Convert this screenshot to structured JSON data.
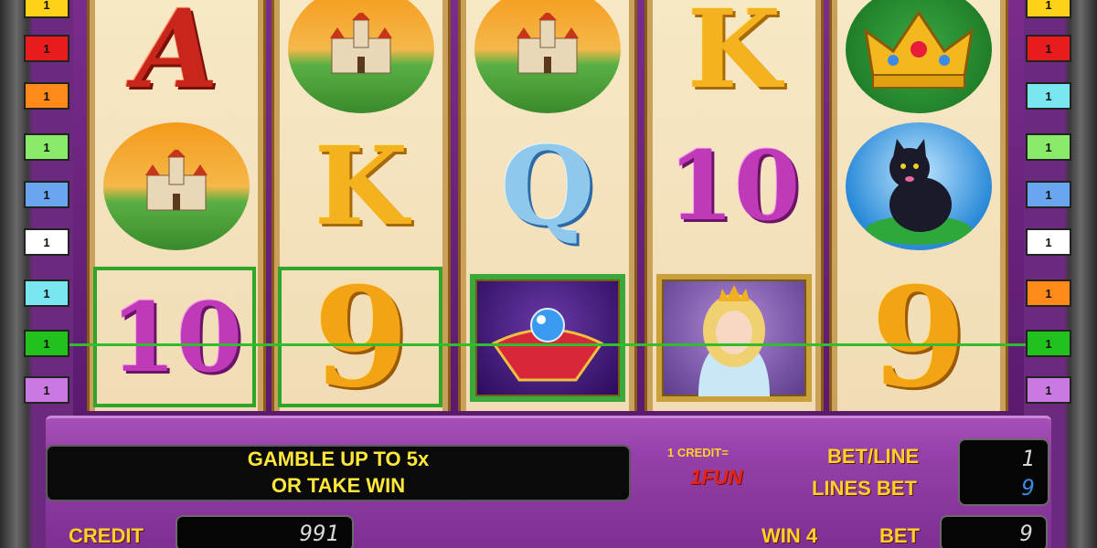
{
  "reels": [
    [
      "A",
      "castle",
      "10"
    ],
    [
      "castle",
      "K",
      "9"
    ],
    [
      "castle",
      "Q",
      "gem"
    ],
    [
      "K",
      "10",
      "princess"
    ],
    [
      "crown",
      "cat",
      "9"
    ]
  ],
  "markers": {
    "left": [
      {
        "label": "1",
        "color": "#ffd21a"
      },
      {
        "label": "1",
        "color": "#e81c1c"
      },
      {
        "label": "1",
        "color": "#ff8a1a"
      },
      {
        "label": "1",
        "color": "#8aea6a"
      },
      {
        "label": "1",
        "color": "#6aa6f0"
      },
      {
        "label": "1",
        "color": "#ffffff"
      },
      {
        "label": "1",
        "color": "#7ae6f0"
      },
      {
        "label": "1",
        "color": "#22c21e"
      },
      {
        "label": "1",
        "color": "#c87ae0"
      }
    ],
    "right": [
      {
        "label": "1",
        "color": "#ffd21a"
      },
      {
        "label": "1",
        "color": "#e81c1c"
      },
      {
        "label": "1",
        "color": "#7ae6f0"
      },
      {
        "label": "1",
        "color": "#8aea6a"
      },
      {
        "label": "1",
        "color": "#6aa6f0"
      },
      {
        "label": "1",
        "color": "#ffffff"
      },
      {
        "label": "1",
        "color": "#ff8a1a"
      },
      {
        "label": "1",
        "color": "#22c21e"
      },
      {
        "label": "1",
        "color": "#c87ae0"
      }
    ]
  },
  "message": {
    "line1": "GAMBLE UP TO 5x",
    "line2": "OR TAKE WIN"
  },
  "denomination": {
    "label": "1 CREDIT=",
    "value": "1FUN"
  },
  "bet_line": {
    "label": "BET/LINE",
    "value": "1"
  },
  "lines_bet": {
    "label": "LINES BET",
    "value": "9"
  },
  "credit": {
    "label": "CREDIT",
    "value": "991"
  },
  "win": {
    "label": "WIN 4"
  },
  "bet": {
    "label": "BET",
    "value": "9"
  },
  "colors": {
    "payline": "#2fbf2a",
    "win_box": "#2fa62a",
    "console": "#9440a8",
    "text_gold": "#ffcf2a"
  }
}
